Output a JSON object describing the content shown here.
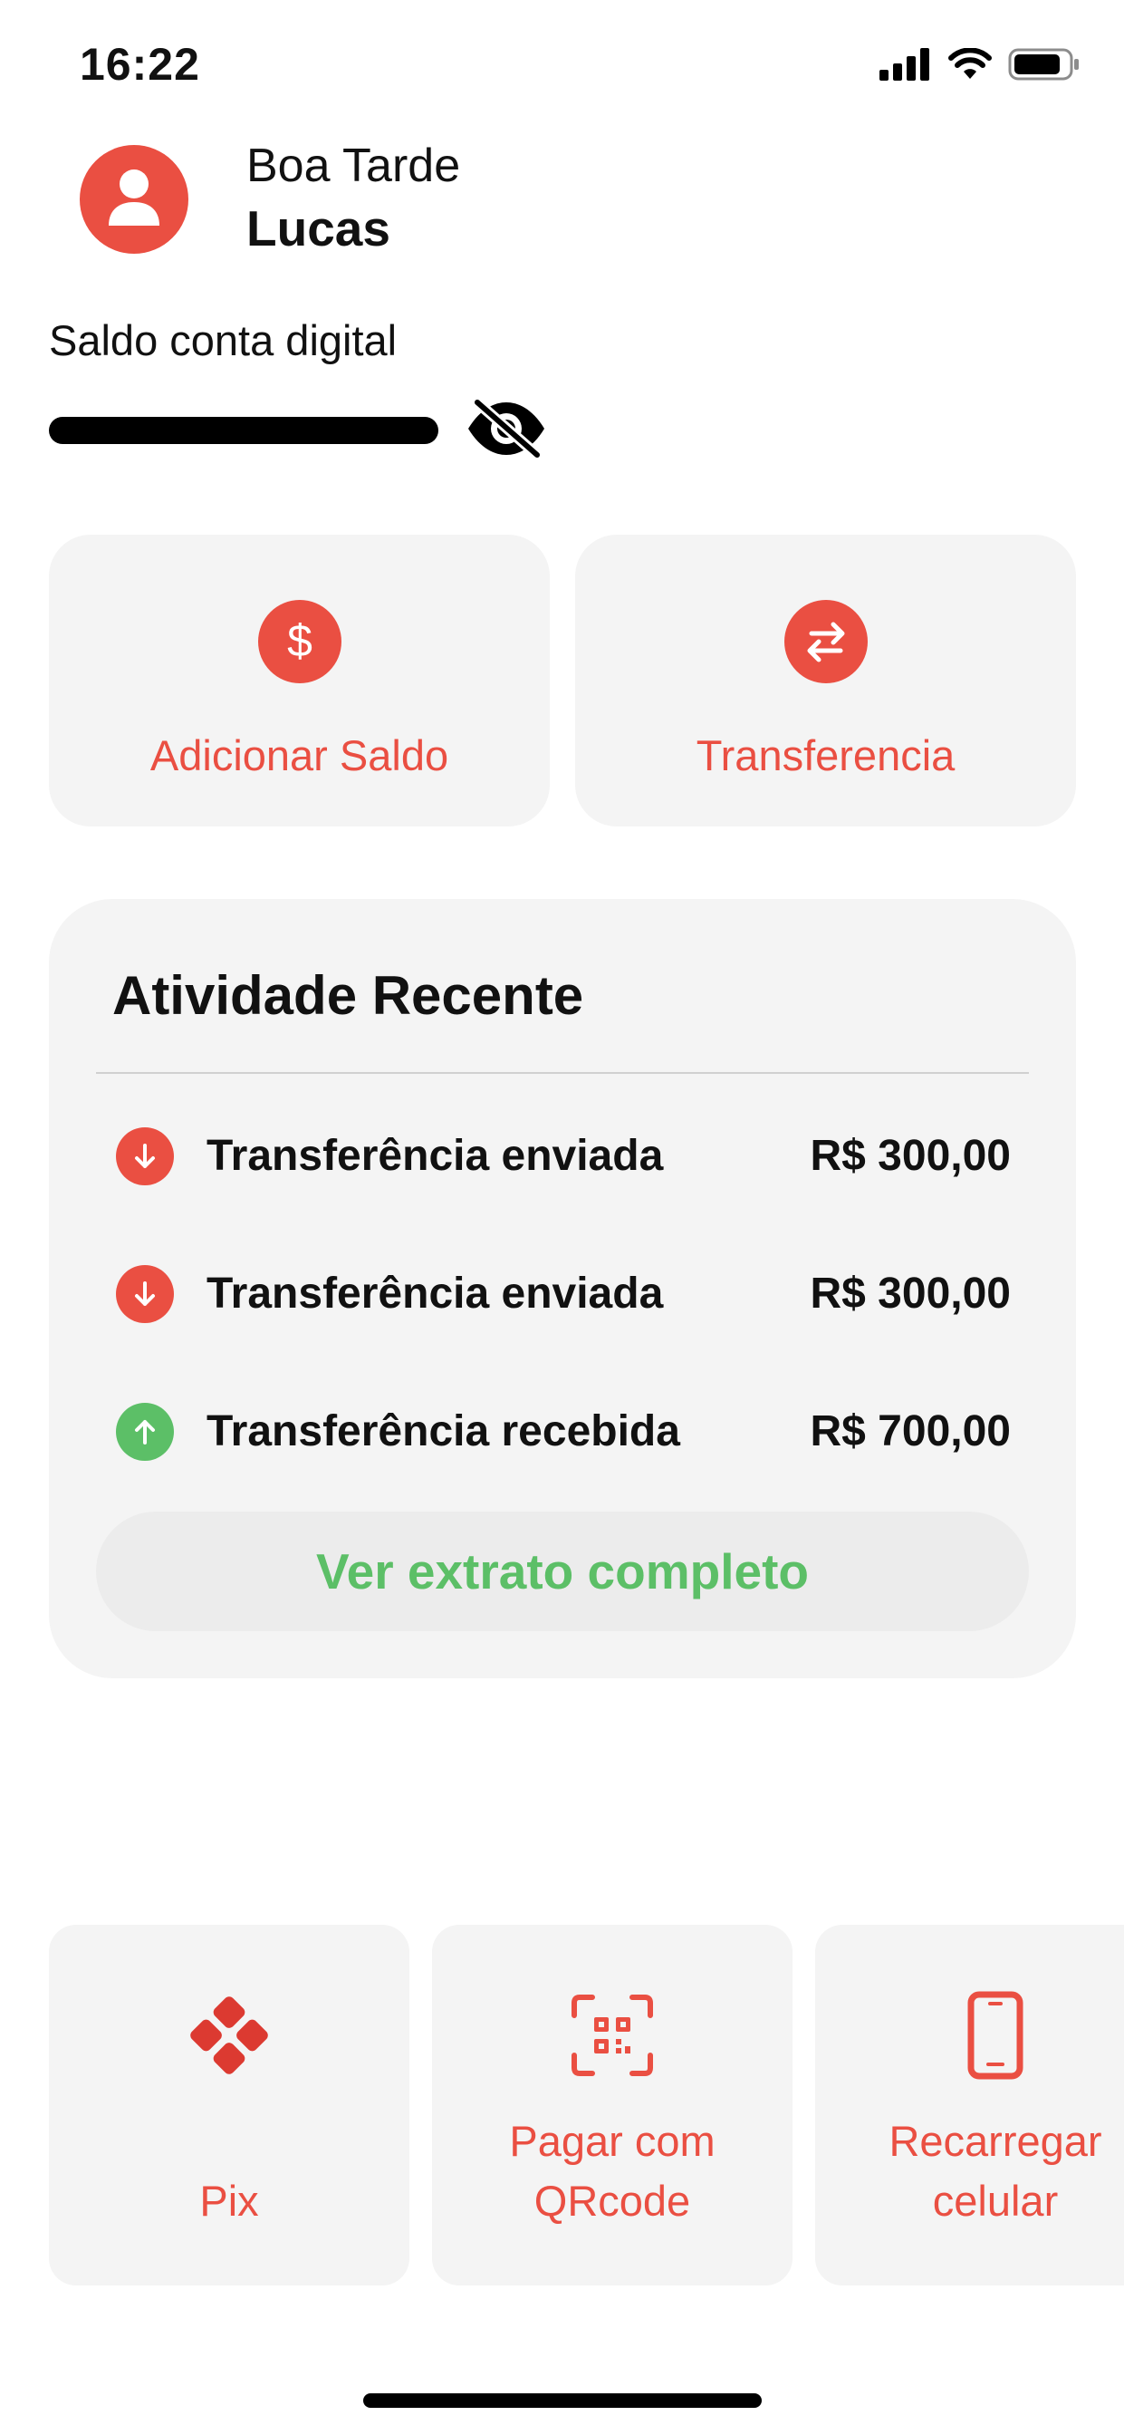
{
  "status_bar": {
    "time": "16:22",
    "icons": [
      "signal-icon",
      "wifi-icon",
      "battery-icon"
    ]
  },
  "header": {
    "greeting": "Boa Tarde",
    "username": "Lucas",
    "avatar_icon": "user-icon"
  },
  "balance": {
    "label": "Saldo conta digital",
    "hidden": true,
    "toggle_icon": "eye-slash-icon"
  },
  "actions": [
    {
      "label": "Adicionar Saldo",
      "icon": "dollar-icon"
    },
    {
      "label": "Transferencia",
      "icon": "transfer-arrows-icon"
    }
  ],
  "activity": {
    "title": "Atividade Recente",
    "transactions": [
      {
        "label": "Transferência enviada",
        "amount": "R$ 300,00",
        "direction": "down",
        "icon": "arrow-down-icon"
      },
      {
        "label": "Transferência enviada",
        "amount": "R$ 300,00",
        "direction": "down",
        "icon": "arrow-down-icon"
      },
      {
        "label": "Transferência recebida",
        "amount": "R$ 700,00",
        "direction": "up",
        "icon": "arrow-up-icon"
      }
    ],
    "statement_button": "Ver extrato completo"
  },
  "shortcuts": [
    {
      "label_lines": [
        "Pix"
      ],
      "icon": "pix-icon"
    },
    {
      "label_lines": [
        "Pagar com",
        "QRcode"
      ],
      "icon": "qr-scan-icon"
    },
    {
      "label_lines": [
        "Recarregar",
        "celular"
      ],
      "icon": "phone-icon"
    }
  ],
  "colors": {
    "accent": "#ea4f42",
    "positive": "#5cbf67",
    "card_bg": "#f4f4f4",
    "text": "#111111"
  }
}
